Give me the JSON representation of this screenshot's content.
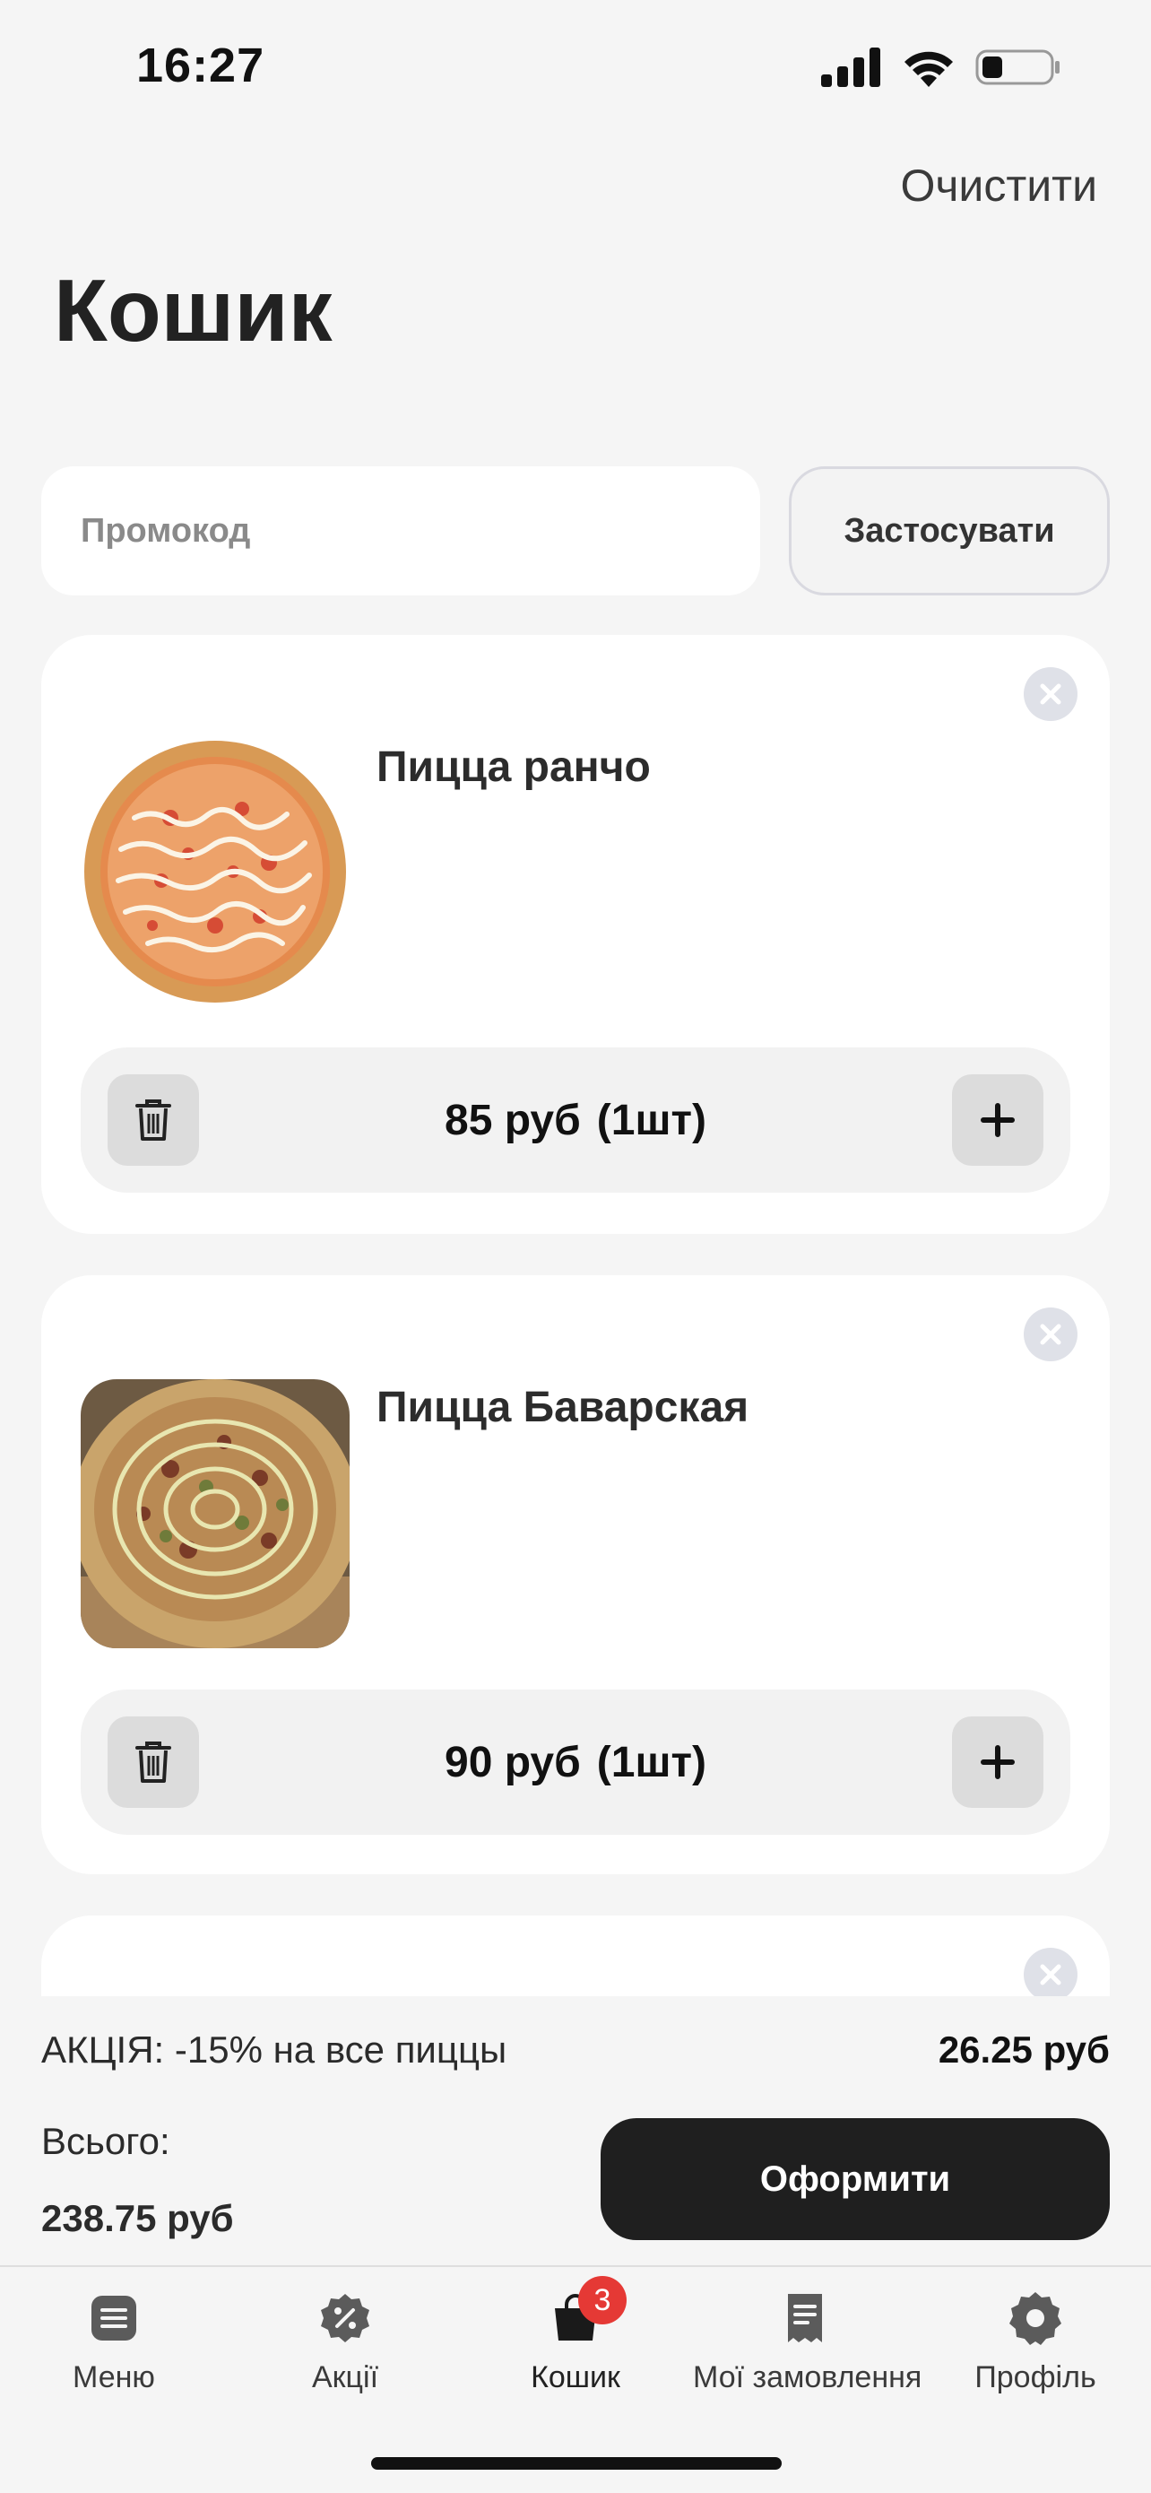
{
  "status_bar": {
    "time": "16:27"
  },
  "header": {
    "clear_label": "Очистити",
    "title": "Кошик"
  },
  "promo": {
    "placeholder": "Промокод",
    "apply_label": "Застосувати"
  },
  "cart_items": [
    {
      "name": "Пицца ранчо",
      "price": "85 руб",
      "qty": "(1шт)"
    },
    {
      "name": "Пицца Баварская",
      "price": "90 руб",
      "qty": "(1шт)"
    }
  ],
  "summary": {
    "promo_label": "АКЦІЯ: -15% на все пиццы",
    "promo_amount": "26.25 руб",
    "total_label": "Всього:",
    "total_amount": "238.75 руб",
    "checkout_label": "Оформити"
  },
  "tabbar": {
    "items": [
      {
        "label": "Меню",
        "icon": "menu-icon"
      },
      {
        "label": "Акції",
        "icon": "discount-icon"
      },
      {
        "label": "Кошик",
        "icon": "cart-icon",
        "badge": "3"
      },
      {
        "label": "Мої замовлення",
        "icon": "receipt-icon"
      },
      {
        "label": "Профіль",
        "icon": "profile-icon"
      }
    ]
  },
  "colors": {
    "accent_dark": "#1f1f1f",
    "badge": "#e53935",
    "background": "#f5f5f5"
  }
}
